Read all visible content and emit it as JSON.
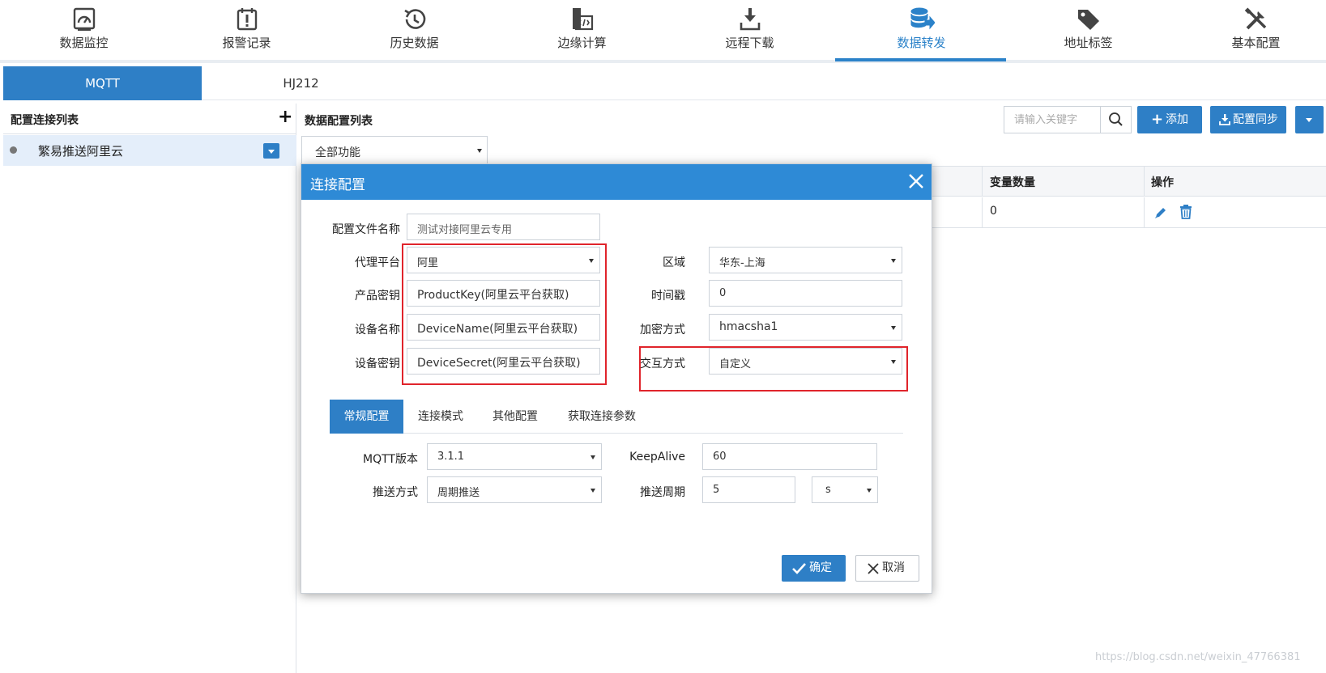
{
  "colors": {
    "accent": "#2e7fc6",
    "modal_header": "#2e8ad6",
    "highlight_red": "#e0242b",
    "selected_row": "#e4eefa"
  },
  "topnav": {
    "items": [
      {
        "label": "数据监控",
        "icon": "gauge-icon"
      },
      {
        "label": "报警记录",
        "icon": "alarm-calendar-icon"
      },
      {
        "label": "历史数据",
        "icon": "history-icon"
      },
      {
        "label": "边缘计算",
        "icon": "code-file-icon"
      },
      {
        "label": "远程下载",
        "icon": "download-icon"
      },
      {
        "label": "数据转发",
        "icon": "database-forward-icon",
        "active": true
      },
      {
        "label": "地址标签",
        "icon": "tag-icon"
      },
      {
        "label": "基本配置",
        "icon": "tools-icon"
      }
    ]
  },
  "protocol_tabs": [
    {
      "label": "MQTT",
      "active": true
    },
    {
      "label": "HJ212",
      "active": false
    }
  ],
  "left_panel": {
    "title": "配置连接列表",
    "add_symbol": "+",
    "items": [
      {
        "label": "繁易推送阿里云",
        "selected": true
      }
    ]
  },
  "main": {
    "title": "数据配置列表",
    "function_select": "全部功能",
    "search_placeholder": "请输入关键字",
    "add_button": "添加",
    "sync_button": "配置同步",
    "table": {
      "headers": {
        "var_count": "变量数量",
        "actions": "操作"
      },
      "rows": [
        {
          "var_count": "0"
        }
      ]
    }
  },
  "modal": {
    "title": "连接配置",
    "fields": {
      "config_name": {
        "label": "配置文件名称",
        "value": "测试对接阿里云专用"
      },
      "proxy_platform": {
        "label": "代理平台",
        "value": "阿里"
      },
      "product_key": {
        "label": "产品密钥",
        "value": "ProductKey(阿里云平台获取)"
      },
      "device_name": {
        "label": "设备名称",
        "value": "DeviceName(阿里云平台获取)"
      },
      "device_secret": {
        "label": "设备密钥",
        "value": "DeviceSecret(阿里云平台获取)"
      },
      "region": {
        "label": "区域",
        "value": "华东-上海"
      },
      "timestamp": {
        "label": "时间戳",
        "value": "0"
      },
      "encryption": {
        "label": "加密方式",
        "value": "hmacsha1"
      },
      "interaction": {
        "label": "交互方式",
        "value": "自定义"
      }
    },
    "sub_tabs": [
      {
        "label": "常规配置",
        "active": true
      },
      {
        "label": "连接模式",
        "active": false
      },
      {
        "label": "其他配置",
        "active": false
      },
      {
        "label": "获取连接参数",
        "active": false
      }
    ],
    "general": {
      "mqtt_version": {
        "label": "MQTT版本",
        "value": "3.1.1"
      },
      "keepalive": {
        "label": "KeepAlive",
        "value": "60"
      },
      "push_mode": {
        "label": "推送方式",
        "value": "周期推送"
      },
      "push_period": {
        "label": "推送周期",
        "value": "5",
        "unit": "s"
      }
    },
    "ok_button": "确定",
    "cancel_button": "取消"
  },
  "watermark": "https://blog.csdn.net/weixin_47766381"
}
